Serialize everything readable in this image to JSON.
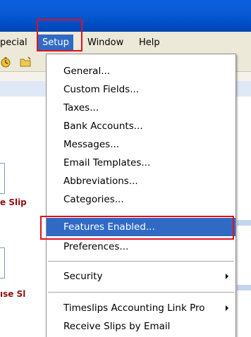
{
  "menubar": {
    "special_label": "pecial",
    "setup_label": "Setup",
    "window_label": "Window",
    "help_label": "Help"
  },
  "setup_menu": {
    "items": [
      {
        "label": "General..."
      },
      {
        "label": "Custom Fields..."
      },
      {
        "label": "Taxes..."
      },
      {
        "label": "Bank Accounts..."
      },
      {
        "label": "Messages..."
      },
      {
        "label": "Email Templates..."
      },
      {
        "label": "Abbreviations..."
      },
      {
        "label": "Categories..."
      },
      {
        "label": "Features Enabled...",
        "highlighted": true
      },
      {
        "label": "Preferences..."
      },
      {
        "label": "Security",
        "submenu": true
      },
      {
        "label": "Timeslips Accounting Link Pro",
        "submenu": true
      },
      {
        "label": "Receive Slips by Email"
      }
    ]
  },
  "background": {
    "label1": "e Slip",
    "label2": "ıse Sl"
  },
  "colors": {
    "titlebar_blue": "#0a5fe0",
    "menu_highlight": "#316ac5",
    "annotation_red": "#e01020",
    "menubar_bg": "#ece9d8",
    "label_dark_red": "#8b1010"
  },
  "icons": {
    "toolbar_icon_1": "stopwatch-icon",
    "toolbar_icon_2": "folder-icon"
  }
}
